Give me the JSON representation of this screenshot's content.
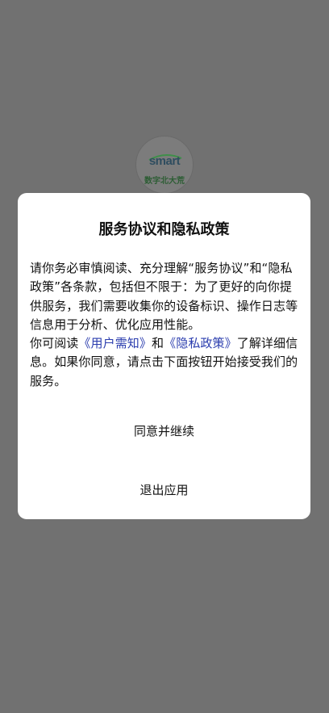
{
  "background_color": "#717171",
  "logo": {
    "brand": "smart",
    "subtitle": "数字北大荒"
  },
  "dialog": {
    "title": "服务协议和隐私政策",
    "paragraph1": "请你务必审慎阅读、充分理解“服务协议”和“隐私政策”各条款，包括但不限于：为了更好的向你提供服务，我们需要收集你的设备标识、操作日志等信息用于分析、优化应用性能。",
    "paragraph2_prefix": "你可阅读",
    "user_notice_link": "《用户需知》",
    "paragraph2_and": "和",
    "privacy_policy_link": "《隐私政策》",
    "paragraph2_suffix": "了解详细信息。如果你同意，请点击下面按钮开始接受我们的服务。",
    "agree_label": "同意并继续",
    "exit_label": "退出应用",
    "link_color": "#2a3cae"
  }
}
